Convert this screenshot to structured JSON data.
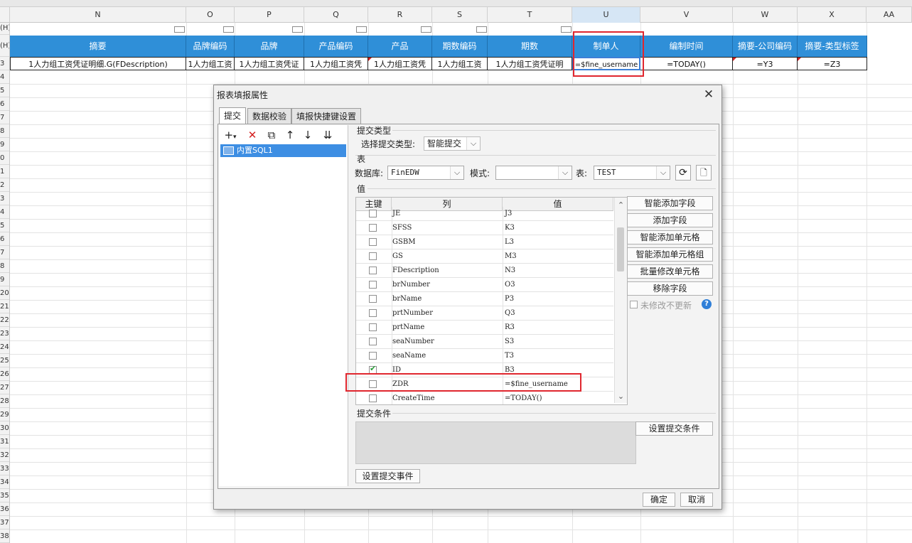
{
  "sheet": {
    "columns": [
      "N",
      "O",
      "P",
      "Q",
      "R",
      "S",
      "T",
      "U",
      "V",
      "W",
      "X",
      "AA"
    ],
    "row_headers": [
      ":::",
      "(H)",
      "(H)",
      "3",
      "4",
      "5",
      "6",
      "7",
      "8",
      "9",
      "0",
      "1",
      "2",
      "3",
      "4",
      "5",
      "6",
      "7",
      "8",
      "9",
      "20",
      "21",
      "22",
      "23",
      "24",
      "25",
      "26",
      "27",
      "28",
      "29",
      "30",
      "31",
      "32",
      "33",
      "34",
      "35",
      "36",
      "37",
      "38"
    ],
    "header_row": [
      "摘要",
      "品牌编码",
      "品牌",
      "产品编码",
      "产品",
      "期数编码",
      "期数",
      "制单人",
      "编制时间",
      "摘要-公司编码",
      "摘要-类型标签"
    ],
    "data_row": [
      "1人力组工资凭证明细.G(FDescription)",
      "1人力组工资",
      "1人力组工资凭证",
      "1人力组工资凭",
      "1人力组工资凭",
      "1人力组工资",
      "1人力组工资凭证明",
      "=$fine_username",
      "=TODAY()",
      "=Y3",
      "=Z3"
    ]
  },
  "dialog": {
    "title": "报表填报属性",
    "tabs": [
      "提交",
      "数据校验",
      "填报快捷键设置"
    ],
    "tree_item": "内置SQL1",
    "submit_type_section": "提交类型",
    "submit_type_label": "选择提交类型:",
    "submit_type_value": "智能提交",
    "table_section": "表",
    "db_label": "数据库:",
    "db_value": "FinEDW",
    "schema_label": "模式:",
    "schema_value": "",
    "table_label": "表:",
    "table_value": "TEST",
    "value_section": "值",
    "columns": [
      "主键",
      "列",
      "值"
    ],
    "rows": [
      {
        "col": "JE",
        "val": "J3",
        "key": false
      },
      {
        "col": "SFSS",
        "val": "K3",
        "key": false
      },
      {
        "col": "GSBM",
        "val": "L3",
        "key": false
      },
      {
        "col": "GS",
        "val": "M3",
        "key": false
      },
      {
        "col": "FDescription",
        "val": "N3",
        "key": false
      },
      {
        "col": "brNumber",
        "val": "O3",
        "key": false
      },
      {
        "col": "brName",
        "val": "P3",
        "key": false
      },
      {
        "col": "prtNumber",
        "val": "Q3",
        "key": false
      },
      {
        "col": "prtName",
        "val": "R3",
        "key": false
      },
      {
        "col": "seaNumber",
        "val": "S3",
        "key": false
      },
      {
        "col": "seaName",
        "val": "T3",
        "key": false
      },
      {
        "col": "ID",
        "val": "B3",
        "key": true
      },
      {
        "col": "ZDR",
        "val": "=$fine_username",
        "key": false
      },
      {
        "col": "CreateTime",
        "val": "=TODAY()",
        "key": false
      }
    ],
    "right_buttons": [
      "智能添加字段",
      "添加字段",
      "智能添加单元格",
      "智能添加单元格组",
      "批量修改单元格",
      "移除字段"
    ],
    "no_update_label": "未修改不更新",
    "condition_section": "提交条件",
    "set_condition_button": "设置提交条件",
    "set_event_button": "设置提交事件",
    "ok_button": "确定",
    "cancel_button": "取消"
  },
  "colors": {
    "header_blue": "#2f8fd8",
    "highlight_red": "#e0262e",
    "selection_blue": "#3d8ee3"
  }
}
